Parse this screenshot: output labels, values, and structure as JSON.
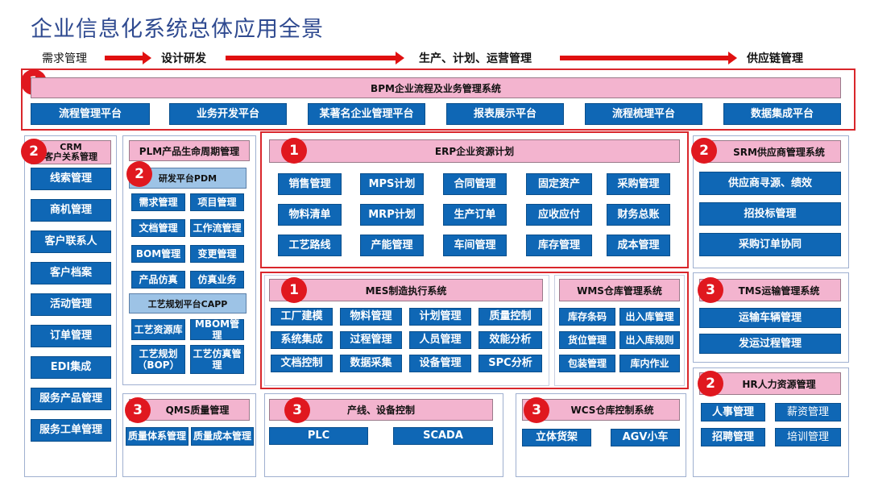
{
  "title": "企业信息化系统总体应用全景",
  "flow": [
    "需求管理",
    "设计研发",
    "生产、计划、运营管理",
    "供应链管理"
  ],
  "badges": {
    "one": "1",
    "two": "2",
    "three": "3"
  },
  "bpm": {
    "title": "BPM企业流程及业务管理系统",
    "items": [
      "流程管理平台",
      "业务开发平台",
      "某著名企业管理平台",
      "报表展示平台",
      "流程梳理平台",
      "数据集成平台"
    ]
  },
  "crm": {
    "title_line1": "CRM",
    "title_line2": "客户关系管理",
    "items": [
      "线索管理",
      "商机管理",
      "客户联系人",
      "客户档案",
      "活动管理",
      "订单管理",
      "EDI集成",
      "服务产品管理",
      "服务工单管理"
    ]
  },
  "plm": {
    "title": "PLM产品生命周期管理",
    "pdm_title": "研发平台PDM",
    "pdm_items": [
      "需求管理",
      "项目管理",
      "文档管理",
      "工作流管理",
      "BOM管理",
      "变更管理",
      "产品仿真",
      "仿真业务"
    ],
    "capp_title": "工艺规划平台CAPP",
    "capp_items": [
      "工艺资源库",
      "MBOM管理",
      "工艺规划（BOP）",
      "工艺仿真管理"
    ]
  },
  "erp": {
    "title": "ERP企业资源计划",
    "items": [
      "销售管理",
      "MPS计划",
      "合同管理",
      "固定资产",
      "采购管理",
      "物料清单",
      "MRP计划",
      "生产订单",
      "应收应付",
      "财务总账",
      "工艺路线",
      "产能管理",
      "车间管理",
      "库存管理",
      "成本管理"
    ]
  },
  "srm": {
    "title": "SRM供应商管理系统",
    "items": [
      "供应商寻源、绩效",
      "招投标管理",
      "采购订单协同"
    ]
  },
  "mes": {
    "title": "MES制造执行系统",
    "items": [
      "工厂建模",
      "物料管理",
      "计划管理",
      "质量控制",
      "系统集成",
      "过程管理",
      "人员管理",
      "效能分析",
      "文档控制",
      "数据采集",
      "设备管理",
      "SPC分析"
    ]
  },
  "wms": {
    "title": "WMS仓库管理系统",
    "items": [
      "库存条码",
      "出入库管理",
      "货位管理",
      "出入库规则",
      "包装管理",
      "库内作业"
    ]
  },
  "tms": {
    "title": "TMS运输管理系统",
    "items": [
      "运输车辆管理",
      "发运过程管理"
    ]
  },
  "hr": {
    "title": "HR人力资源管理",
    "items": [
      "人事管理",
      "薪资管理",
      "招聘管理",
      "培训管理"
    ]
  },
  "qms": {
    "title": "QMS质量管理",
    "items": [
      "质量体系管理",
      "质量成本管理"
    ]
  },
  "line": {
    "title": "产线、设备控制",
    "items": [
      "PLC",
      "SCADA"
    ]
  },
  "wcs": {
    "title": "WCS仓库控制系统",
    "items": [
      "立体货架",
      "AGV小车"
    ]
  }
}
